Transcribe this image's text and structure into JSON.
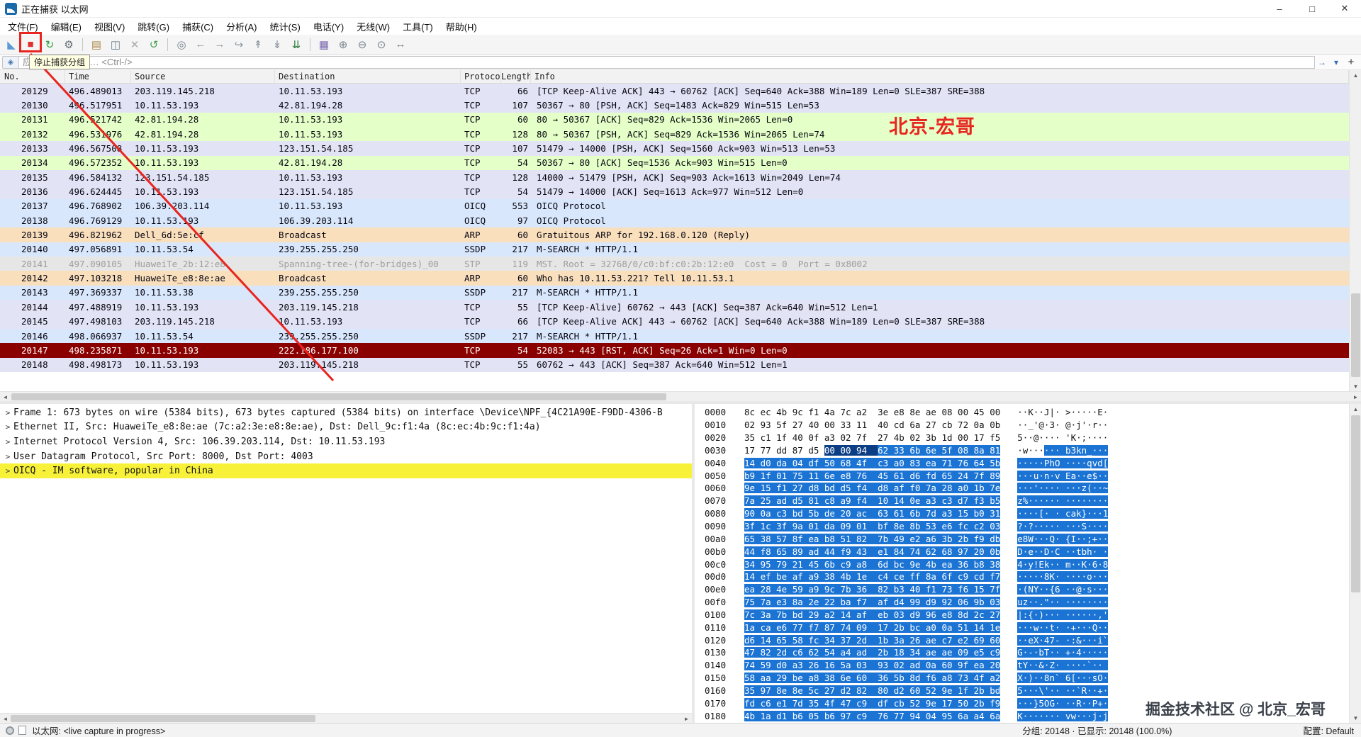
{
  "colors": {
    "annotation": "#e8251f",
    "hex_selection": "#1b74d4",
    "hex_selected_field": "#0c3e86",
    "detail_highlight": "#f7f13a"
  },
  "window": {
    "title": "正在捕获 以太网",
    "controls": {
      "minimize": "–",
      "maximize": "□",
      "close": "✕"
    }
  },
  "menu_bar": {
    "items": [
      {
        "name": "file",
        "label": "文件(F)"
      },
      {
        "name": "edit",
        "label": "编辑(E)"
      },
      {
        "name": "view",
        "label": "视图(V)"
      },
      {
        "name": "go",
        "label": "跳转(G)"
      },
      {
        "name": "capture",
        "label": "捕获(C)"
      },
      {
        "name": "analyze",
        "label": "分析(A)"
      },
      {
        "name": "statistics",
        "label": "统计(S)"
      },
      {
        "name": "telephony",
        "label": "电话(Y)"
      },
      {
        "name": "wireless",
        "label": "无线(W)"
      },
      {
        "name": "tools",
        "label": "工具(T)"
      },
      {
        "name": "help",
        "label": "帮助(H)"
      }
    ]
  },
  "toolbar": {
    "icons": [
      {
        "name": "start-capture",
        "glyph": "◣",
        "color": "#5b9bd5"
      },
      {
        "name": "stop-capture",
        "glyph": "■",
        "color": "#e03131"
      },
      {
        "name": "restart-capture",
        "glyph": "↻",
        "color": "#2f9e44"
      },
      {
        "name": "capture-options",
        "glyph": "⚙",
        "color": "#5f6b76"
      },
      {
        "name": "sep"
      },
      {
        "name": "open-file",
        "glyph": "▤",
        "color": "#b08a4f"
      },
      {
        "name": "save-file",
        "glyph": "◫",
        "color": "#6d7f93"
      },
      {
        "name": "close-file",
        "glyph": "✕",
        "color": "#a9a9a9"
      },
      {
        "name": "reload",
        "glyph": "↺",
        "color": "#3f9e4d"
      },
      {
        "name": "sep"
      },
      {
        "name": "find-packet",
        "glyph": "◎",
        "color": "#75818c"
      },
      {
        "name": "go-back",
        "glyph": "←",
        "color": "#8d98a3"
      },
      {
        "name": "go-forward",
        "glyph": "→",
        "color": "#8d98a3"
      },
      {
        "name": "go-to-packet",
        "glyph": "↪",
        "color": "#8d98a3"
      },
      {
        "name": "go-first",
        "glyph": "↟",
        "color": "#8d98a3"
      },
      {
        "name": "go-last",
        "glyph": "↡",
        "color": "#8d98a3"
      },
      {
        "name": "auto-scroll",
        "glyph": "⇊",
        "color": "#2b7a3b"
      },
      {
        "name": "sep"
      },
      {
        "name": "colorize",
        "glyph": "▦",
        "color": "#7b68ae"
      },
      {
        "name": "zoom-in",
        "glyph": "⊕",
        "color": "#75818c"
      },
      {
        "name": "zoom-out",
        "glyph": "⊖",
        "color": "#75818c"
      },
      {
        "name": "zoom-reset",
        "glyph": "⊙",
        "color": "#75818c"
      },
      {
        "name": "resize-columns",
        "glyph": "↔",
        "color": "#75818c"
      }
    ]
  },
  "filter_bar": {
    "bookmark_glyph": "◈",
    "placeholder": "应用显示过滤器 … <Ctrl-/>",
    "history_glyph": "▾",
    "apply_glyph": "→",
    "add_label": "+"
  },
  "tooltip": {
    "text": "停止捕获分组"
  },
  "packet_list": {
    "columns": [
      {
        "key": "no",
        "label": "No."
      },
      {
        "key": "time",
        "label": "Time"
      },
      {
        "key": "src",
        "label": "Source"
      },
      {
        "key": "dst",
        "label": "Destination"
      },
      {
        "key": "proto",
        "label": "Protocol"
      },
      {
        "key": "len",
        "label": "Length"
      },
      {
        "key": "info",
        "label": "Info"
      }
    ],
    "colors": {
      "tcp": {
        "bg": "#e3e3f6",
        "fg": "#05050f"
      },
      "http": {
        "bg": "#e4ffc7",
        "fg": "#05050f"
      },
      "udp": {
        "bg": "#d9e7fc",
        "fg": "#05050f"
      },
      "arp": {
        "bg": "#fadfbd",
        "fg": "#05050f"
      },
      "stp": {
        "bg": "#e6e6e6",
        "fg": "#9d9d9d"
      },
      "bad": {
        "bg": "#8a0000",
        "fg": "#ffffff"
      }
    },
    "rows": [
      {
        "no": "20129",
        "time": "496.489013",
        "src": "203.119.145.218",
        "dst": "10.11.53.193",
        "proto": "TCP",
        "len": "66",
        "color": "tcp",
        "info": "[TCP Keep-Alive ACK] 443 → 60762 [ACK] Seq=640 Ack=388 Win=189 Len=0 SLE=387 SRE=388"
      },
      {
        "no": "20130",
        "time": "496.517951",
        "src": "10.11.53.193",
        "dst": "42.81.194.28",
        "proto": "TCP",
        "len": "107",
        "color": "tcp",
        "info": "50367 → 80 [PSH, ACK] Seq=1483 Ack=829 Win=515 Len=53"
      },
      {
        "no": "20131",
        "time": "496.521742",
        "src": "42.81.194.28",
        "dst": "10.11.53.193",
        "proto": "TCP",
        "len": "60",
        "color": "http",
        "info": "80 → 50367 [ACK] Seq=829 Ack=1536 Win=2065 Len=0"
      },
      {
        "no": "20132",
        "time": "496.531976",
        "src": "42.81.194.28",
        "dst": "10.11.53.193",
        "proto": "TCP",
        "len": "128",
        "color": "http",
        "info": "80 → 50367 [PSH, ACK] Seq=829 Ack=1536 Win=2065 Len=74"
      },
      {
        "no": "20133",
        "time": "496.567508",
        "src": "10.11.53.193",
        "dst": "123.151.54.185",
        "proto": "TCP",
        "len": "107",
        "color": "tcp",
        "info": "51479 → 14000 [PSH, ACK] Seq=1560 Ack=903 Win=513 Len=53"
      },
      {
        "no": "20134",
        "time": "496.572352",
        "src": "10.11.53.193",
        "dst": "42.81.194.28",
        "proto": "TCP",
        "len": "54",
        "color": "http",
        "info": "50367 → 80 [ACK] Seq=1536 Ack=903 Win=515 Len=0"
      },
      {
        "no": "20135",
        "time": "496.584132",
        "src": "123.151.54.185",
        "dst": "10.11.53.193",
        "proto": "TCP",
        "len": "128",
        "color": "tcp",
        "info": "14000 → 51479 [PSH, ACK] Seq=903 Ack=1613 Win=2049 Len=74"
      },
      {
        "no": "20136",
        "time": "496.624445",
        "src": "10.11.53.193",
        "dst": "123.151.54.185",
        "proto": "TCP",
        "len": "54",
        "color": "tcp",
        "info": "51479 → 14000 [ACK] Seq=1613 Ack=977 Win=512 Len=0"
      },
      {
        "no": "20137",
        "time": "496.768902",
        "src": "106.39.203.114",
        "dst": "10.11.53.193",
        "proto": "OICQ",
        "len": "553",
        "color": "udp",
        "info": "OICQ Protocol"
      },
      {
        "no": "20138",
        "time": "496.769129",
        "src": "10.11.53.193",
        "dst": "106.39.203.114",
        "proto": "OICQ",
        "len": "97",
        "color": "udp",
        "info": "OICQ Protocol"
      },
      {
        "no": "20139",
        "time": "496.821962",
        "src": "Dell_6d:5e:cf",
        "dst": "Broadcast",
        "proto": "ARP",
        "len": "60",
        "color": "arp",
        "info": "Gratuitous ARP for 192.168.0.120 (Reply)"
      },
      {
        "no": "20140",
        "time": "497.056891",
        "src": "10.11.53.54",
        "dst": "239.255.255.250",
        "proto": "SSDP",
        "len": "217",
        "color": "udp",
        "info": "M-SEARCH * HTTP/1.1"
      },
      {
        "no": "20141",
        "time": "497.090105",
        "src": "HuaweiTe_2b:12:e8",
        "dst": "Spanning-tree-(for-bridges)_00",
        "proto": "STP",
        "len": "119",
        "color": "stp",
        "info": "MST. Root = 32768/0/c0:bf:c0:2b:12:e0  Cost = 0  Port = 0x8002"
      },
      {
        "no": "20142",
        "time": "497.103218",
        "src": "HuaweiTe_e8:8e:ae",
        "dst": "Broadcast",
        "proto": "ARP",
        "len": "60",
        "color": "arp",
        "info": "Who has 10.11.53.221? Tell 10.11.53.1"
      },
      {
        "no": "20143",
        "time": "497.369337",
        "src": "10.11.53.38",
        "dst": "239.255.255.250",
        "proto": "SSDP",
        "len": "217",
        "color": "udp",
        "info": "M-SEARCH * HTTP/1.1"
      },
      {
        "no": "20144",
        "time": "497.488919",
        "src": "10.11.53.193",
        "dst": "203.119.145.218",
        "proto": "TCP",
        "len": "55",
        "color": "tcp",
        "info": "[TCP Keep-Alive] 60762 → 443 [ACK] Seq=387 Ack=640 Win=512 Len=1"
      },
      {
        "no": "20145",
        "time": "497.498103",
        "src": "203.119.145.218",
        "dst": "10.11.53.193",
        "proto": "TCP",
        "len": "66",
        "color": "tcp",
        "info": "[TCP Keep-Alive ACK] 443 → 60762 [ACK] Seq=640 Ack=388 Win=189 Len=0 SLE=387 SRE=388"
      },
      {
        "no": "20146",
        "time": "498.066937",
        "src": "10.11.53.54",
        "dst": "239.255.255.250",
        "proto": "SSDP",
        "len": "217",
        "color": "udp",
        "info": "M-SEARCH * HTTP/1.1"
      },
      {
        "no": "20147",
        "time": "498.235871",
        "src": "10.11.53.193",
        "dst": "222.186.177.100",
        "proto": "TCP",
        "len": "54",
        "color": "bad",
        "info": "52083 → 443 [RST, ACK] Seq=26 Ack=1 Win=0 Len=0"
      },
      {
        "no": "20148",
        "time": "498.498173",
        "src": "10.11.53.193",
        "dst": "203.119.145.218",
        "proto": "TCP",
        "len": "55",
        "color": "tcp",
        "info": "60762 → 443 [ACK] Seq=387 Ack=640 Win=512 Len=1"
      }
    ]
  },
  "details_pane": {
    "expander_glyph": ">",
    "lines": [
      {
        "highlight": false,
        "text": "Frame 1: 673 bytes on wire (5384 bits), 673 bytes captured (5384 bits) on interface \\Device\\NPF_{4C21A90E-F9DD-4306-B"
      },
      {
        "highlight": false,
        "text": "Ethernet II, Src: HuaweiTe_e8:8e:ae (7c:a2:3e:e8:8e:ae), Dst: Dell_9c:f1:4a (8c:ec:4b:9c:f1:4a)"
      },
      {
        "highlight": false,
        "text": "Internet Protocol Version 4, Src: 106.39.203.114, Dst: 10.11.53.193"
      },
      {
        "highlight": false,
        "text": "User Datagram Protocol, Src Port: 8000, Dst Port: 4003"
      },
      {
        "highlight": true,
        "text": "OICQ - IM software, popular in China"
      }
    ]
  },
  "hex_dump": {
    "selection": {
      "row": 3,
      "byte": 5,
      "field_bytes": [
        5,
        7
      ]
    },
    "rows": [
      {
        "offset": "0000",
        "bytes": "8c ec 4b 9c f1 4a 7c a2 3e e8 8e ae 08 00 45 00"
      },
      {
        "offset": "0010",
        "bytes": "02 93 5f 27 40 00 33 11 40 cd 6a 27 cb 72 0a 0b"
      },
      {
        "offset": "0020",
        "bytes": "35 c1 1f 40 0f a3 02 7f 27 4b 02 3b 1d 00 17 f5"
      },
      {
        "offset": "0030",
        "bytes": "17 77 dd 87 d5 00 00 94 62 33 6b 6e 5f 08 8a 81"
      },
      {
        "offset": "0040",
        "bytes": "14 d0 da 04 df 50 68 4f c3 a0 83 ea 71 76 64 5b"
      },
      {
        "offset": "0050",
        "bytes": "b9 1f 01 75 11 6e e8 76 45 61 d6 fd 65 24 7f 89"
      },
      {
        "offset": "0060",
        "bytes": "9e 15 f1 27 d8 bd d5 f4 d8 af f0 7a 28 a0 1b 7e"
      },
      {
        "offset": "0070",
        "bytes": "7a 25 ad d5 81 c8 a9 f4 10 14 0e a3 c3 d7 f3 b5"
      },
      {
        "offset": "0080",
        "bytes": "90 0a c3 bd 5b de 20 ac 63 61 6b 7d a3 15 b0 31"
      },
      {
        "offset": "0090",
        "bytes": "3f 1c 3f 9a 01 da 09 01 bf 8e 8b 53 e6 fc c2 03"
      },
      {
        "offset": "00a0",
        "bytes": "65 38 57 8f ea b8 51 82 7b 49 e2 a6 3b 2b f9 db"
      },
      {
        "offset": "00b0",
        "bytes": "44 f8 65 89 ad 44 f9 43 e1 84 74 62 68 97 20 0b"
      },
      {
        "offset": "00c0",
        "bytes": "34 95 79 21 45 6b c9 a8 6d bc 9e 4b ea 36 b8 38"
      },
      {
        "offset": "00d0",
        "bytes": "14 ef be af a9 38 4b 1e c4 ce ff 8a 6f c9 cd f7"
      },
      {
        "offset": "00e0",
        "bytes": "ea 28 4e 59 a9 9c 7b 36 82 b3 40 f1 73 f6 15 7f"
      },
      {
        "offset": "00f0",
        "bytes": "75 7a e3 8a 2e 22 ba f7 af d4 99 d9 92 06 9b 03"
      },
      {
        "offset": "0100",
        "bytes": "7c 3a 7b bd 29 a2 14 af eb 03 d9 96 e8 8d 2c 27"
      },
      {
        "offset": "0110",
        "bytes": "1a ca e6 77 f7 87 74 09 17 2b bc a0 0a 51 14 1e"
      },
      {
        "offset": "0120",
        "bytes": "d6 14 65 58 fc 34 37 2d 1b 3a 26 ae c7 e2 69 60"
      },
      {
        "offset": "0130",
        "bytes": "47 82 2d c6 62 54 a4 ad 2b 18 34 ae ae 09 e5 c9"
      },
      {
        "offset": "0140",
        "bytes": "74 59 d0 a3 26 16 5a 03 93 02 ad 0a 60 9f ea 20"
      },
      {
        "offset": "0150",
        "bytes": "58 aa 29 be a8 38 6e 60 36 5b 8d f6 a8 73 4f a2"
      },
      {
        "offset": "0160",
        "bytes": "35 97 8e 8e 5c 27 d2 82 80 d2 60 52 9e 1f 2b bd"
      },
      {
        "offset": "0170",
        "bytes": "fd c6 e1 7d 35 4f 47 c9 df cb 52 9e 17 50 2b f9"
      },
      {
        "offset": "0180",
        "bytes": "4b 1a d1 b6 05 b6 97 c9 76 77 94 04 95 6a a4 6a"
      }
    ]
  },
  "status_bar": {
    "interface_label": "以太网: <live capture in progress>",
    "packets_label": "分组: 20148 · 已显示: 20148 (100.0%)",
    "profile_label": "配置: Default"
  },
  "annotations": {
    "label": "北京-宏哥",
    "watermark": "掘金技术社区 @ 北京_宏哥"
  }
}
